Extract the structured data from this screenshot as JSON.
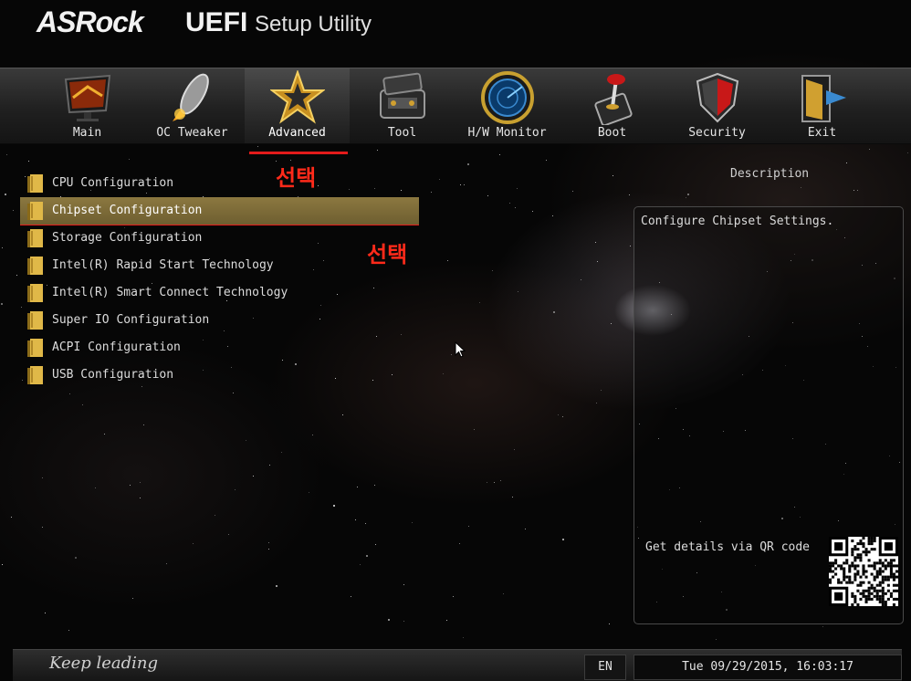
{
  "header": {
    "brand": "ASRock",
    "title_uefi": "UEFI",
    "title_rest": "Setup Utility"
  },
  "nav": {
    "tabs": [
      {
        "label": "Main",
        "icon": "monitor-icon"
      },
      {
        "label": "OC Tweaker",
        "icon": "rocket-icon"
      },
      {
        "label": "Advanced",
        "icon": "star-icon"
      },
      {
        "label": "Tool",
        "icon": "toolbox-icon"
      },
      {
        "label": "H/W Monitor",
        "icon": "radar-icon"
      },
      {
        "label": "Boot",
        "icon": "joystick-icon"
      },
      {
        "label": "Security",
        "icon": "shield-icon"
      },
      {
        "label": "Exit",
        "icon": "exit-door-icon"
      }
    ],
    "active": "Advanced"
  },
  "annotations": {
    "tab_mark": "선택",
    "item_mark": "선택",
    "color": "#e31b1b"
  },
  "menu": {
    "items": [
      {
        "label": "CPU Configuration"
      },
      {
        "label": "Chipset Configuration"
      },
      {
        "label": "Storage Configuration"
      },
      {
        "label": "Intel(R) Rapid Start Technology"
      },
      {
        "label": "Intel(R) Smart Connect Technology"
      },
      {
        "label": "Super IO Configuration"
      },
      {
        "label": "ACPI Configuration"
      },
      {
        "label": "USB Configuration"
      }
    ],
    "selected": "Chipset Configuration"
  },
  "description": {
    "heading": "Description",
    "text": "Configure Chipset Settings.",
    "qr_label": "Get details via QR code"
  },
  "footer": {
    "slogan": "Keep leading",
    "language": "EN",
    "datetime": "Tue 09/29/2015, 16:03:17"
  },
  "colors": {
    "selection": "#7d6c38",
    "annotation": "#e31b1b"
  }
}
